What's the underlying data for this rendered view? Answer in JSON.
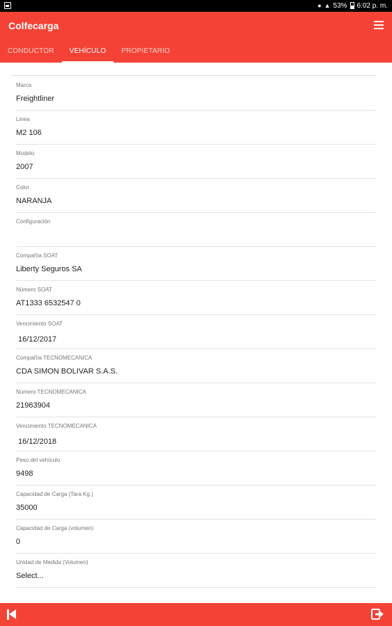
{
  "status_bar": {
    "battery": "53%",
    "time": "6:02 p. m."
  },
  "app": {
    "title": "Colfecarga"
  },
  "tabs": [
    {
      "label": "CONDUCTOR",
      "active": false
    },
    {
      "label": "VEHÍCULO",
      "active": true
    },
    {
      "label": "PROPIETARIO",
      "active": false
    }
  ],
  "fields": [
    {
      "label": "Marca",
      "value": "Freightliner"
    },
    {
      "label": "Linea",
      "value": "M2 106"
    },
    {
      "label": "Modelo",
      "value": "2007"
    },
    {
      "label": "Color",
      "value": "NARANJA"
    },
    {
      "label": "Configuración",
      "value": ""
    },
    {
      "label": "Compañía SOAT",
      "value": "Liberty Seguros SA"
    },
    {
      "label": "Número SOAT",
      "value": "AT1333 6532547 0"
    },
    {
      "label": "Vencimiento SOAT",
      "value": "16/12/2017"
    },
    {
      "label": "Compañía TECNOMECANICA",
      "value": "CDA SIMON BOLIVAR S.A.S."
    },
    {
      "label": "Número TECNOMECANICA",
      "value": "21963904"
    },
    {
      "label": "Vencimiento TECNOMECANICA",
      "value": "16/12/2018"
    },
    {
      "label": "Peso del vehículo",
      "value": "9498"
    },
    {
      "label": "Capacidad de Carga (Tara Kg.)",
      "value": "35000"
    },
    {
      "label": "Capacidad de Carga (volumen)",
      "value": "0"
    },
    {
      "label": "Unidad de Medida (Volumen)",
      "value": "Select..."
    }
  ],
  "colors": {
    "accent": "#f44336",
    "status_bar": "#000000"
  },
  "icons": {
    "menu": "hamburger-menu-icon",
    "first": "skip-to-first-icon",
    "logout": "logout-icon"
  }
}
